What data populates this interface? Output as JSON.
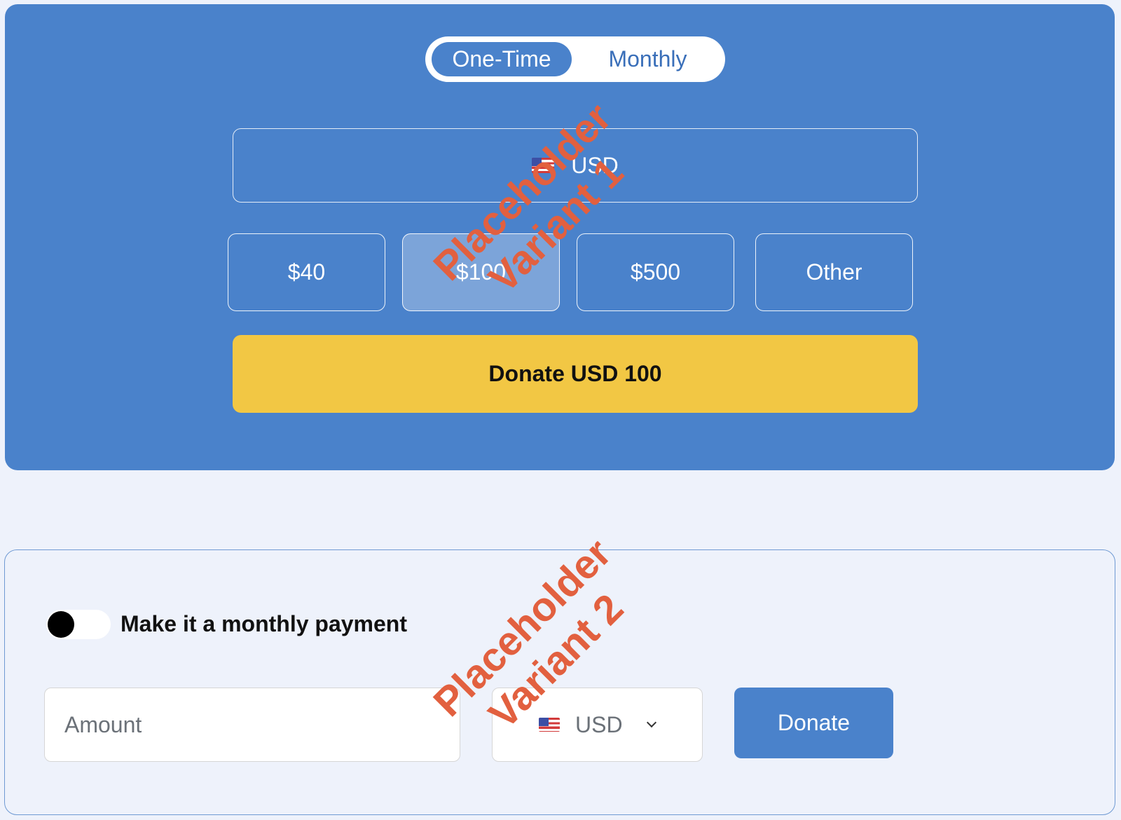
{
  "variant1": {
    "frequency": {
      "one_time_label": "One-Time",
      "monthly_label": "Monthly",
      "selected": "One-Time"
    },
    "currency": {
      "code": "USD",
      "flag_icon": "us-flag-icon"
    },
    "amounts": [
      {
        "label": "$40",
        "selected": false
      },
      {
        "label": "$100",
        "selected": true
      },
      {
        "label": "$500",
        "selected": false
      },
      {
        "label": "Other",
        "selected": false
      }
    ],
    "donate_label": "Donate USD 100",
    "watermark_line1": "Placeholder",
    "watermark_line2": "Variant 1",
    "colors": {
      "panel": "#4a82cb",
      "donate_button": "#f2c744",
      "watermark": "#e2603f"
    }
  },
  "variant2": {
    "monthly_toggle_label": "Make it a monthly payment",
    "monthly_toggle_on": false,
    "amount_placeholder": "Amount",
    "currency": {
      "code": "USD",
      "flag_icon": "us-flag-icon"
    },
    "donate_label": "Donate",
    "watermark_line1": "Placeholder",
    "watermark_line2": "Variant 2",
    "colors": {
      "donate_button": "#4a82cb",
      "panel_border": "#6f9ad3"
    }
  }
}
